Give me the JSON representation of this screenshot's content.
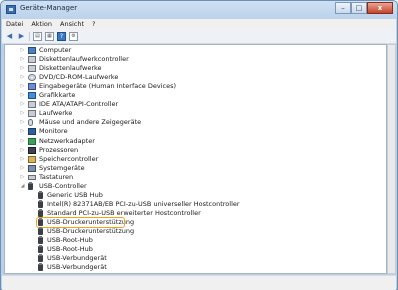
{
  "window": {
    "title": "Geräte-Manager"
  },
  "menu": [
    {
      "label": "Datei"
    },
    {
      "label": "Aktion"
    },
    {
      "label": "Ansicht"
    },
    {
      "label": "?"
    }
  ],
  "toolbar_icons": [
    "back-arrow-icon",
    "forward-arrow-icon",
    "view-icon",
    "properties-icon",
    "help-icon",
    "scan-icon"
  ],
  "tree": [
    {
      "label": "Computer",
      "icon": "computer-icon",
      "expanded": false
    },
    {
      "label": "Diskettenlaufwerkcontroller",
      "icon": "controller-icon",
      "expanded": false
    },
    {
      "label": "Diskettenlaufwerke",
      "icon": "floppy-drive-icon",
      "expanded": false
    },
    {
      "label": "DVD/CD-ROM-Laufwerke",
      "icon": "cd-drive-icon",
      "expanded": false
    },
    {
      "label": "Eingabegeräte (Human Interface Devices)",
      "icon": "input-device-icon",
      "expanded": false
    },
    {
      "label": "Grafikkarte",
      "icon": "display-adapter-icon",
      "expanded": false
    },
    {
      "label": "IDE ATA/ATAPI-Controller",
      "icon": "ide-controller-icon",
      "expanded": false
    },
    {
      "label": "Laufwerke",
      "icon": "drive-icon",
      "expanded": false
    },
    {
      "label": "Mäuse und andere Zeigegeräte",
      "icon": "mouse-icon",
      "expanded": false
    },
    {
      "label": "Monitore",
      "icon": "monitor-icon",
      "expanded": false
    },
    {
      "label": "Netzwerkadapter",
      "icon": "network-adapter-icon",
      "expanded": false
    },
    {
      "label": "Prozessoren",
      "icon": "processor-icon",
      "expanded": false
    },
    {
      "label": "Speichercontroller",
      "icon": "storage-controller-icon",
      "expanded": false
    },
    {
      "label": "Systemgeräte",
      "icon": "system-device-icon",
      "expanded": false
    },
    {
      "label": "Tastaturen",
      "icon": "keyboard-icon",
      "expanded": false
    },
    {
      "label": "USB-Controller",
      "icon": "usb-controller-icon",
      "expanded": true,
      "children": [
        {
          "label": "Generic USB Hub"
        },
        {
          "label": "Intel(R) 82371AB/EB PCI-zu-USB universeller Hostcontroller"
        },
        {
          "label": "Standard PCI-zu-USB erweiterter Hostcontroller"
        },
        {
          "label": "USB-Druckerunterstützung",
          "highlighted": true
        },
        {
          "label": "USB-Druckerunterstützung"
        },
        {
          "label": "USB-Root-Hub"
        },
        {
          "label": "USB-Root-Hub"
        },
        {
          "label": "USB-Verbundgerät"
        },
        {
          "label": "USB-Verbundgerät"
        }
      ]
    }
  ],
  "colors": {
    "highlight": "#f5a21a",
    "titlebar": "#c4d8ee"
  }
}
